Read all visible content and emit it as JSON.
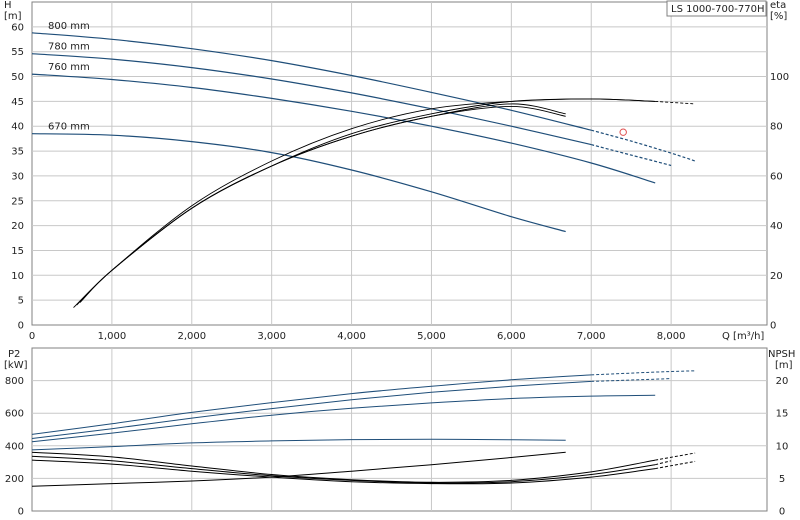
{
  "title": "LS 1000-700-770H",
  "colors": {
    "curve_blue": "#1f4e79",
    "curve_black": "#000000",
    "grid": "#c8c8c8",
    "marker": "#e05050"
  },
  "chart_data": [
    {
      "type": "line",
      "name_key": "head",
      "ylabel_left": "H",
      "ylabel_left_unit": "[m]",
      "ylabel_right": "eta",
      "ylabel_right_unit": "[%]",
      "xlabel": "Q [m³/h]",
      "xlim": [
        0,
        9200
      ],
      "ylim": [
        0,
        65
      ],
      "y2lim": [
        0,
        130
      ],
      "xticks": [
        0,
        1000,
        2000,
        3000,
        4000,
        5000,
        6000,
        7000,
        8000
      ],
      "xtick_labels": [
        "0",
        "1,000",
        "2,000",
        "3,000",
        "4,000",
        "5,000",
        "6,000",
        "7,000",
        "8,000"
      ],
      "yticks": [
        0,
        5,
        10,
        15,
        20,
        25,
        30,
        35,
        40,
        45,
        50,
        55,
        60
      ],
      "y2ticks": [
        0,
        20,
        40,
        60,
        80,
        100
      ],
      "grid": true,
      "head_series": [
        {
          "label": "800 mm",
          "x": [
            0,
            1000,
            2000,
            3000,
            4000,
            5000,
            6000,
            7000
          ],
          "y": [
            58.8,
            57.5,
            55.6,
            53.2,
            50.2,
            46.8,
            43.2,
            39.2
          ],
          "dashed_x": [
            7000,
            7500,
            8000,
            8300
          ],
          "dashed_y": [
            39.2,
            37.0,
            34.6,
            33.0
          ]
        },
        {
          "label": "780 mm",
          "x": [
            0,
            1000,
            2000,
            3000,
            4000,
            5000,
            6000,
            7000
          ],
          "y": [
            54.6,
            53.5,
            51.8,
            49.5,
            46.7,
            43.5,
            40.0,
            36.3
          ],
          "dashed_x": [
            7000,
            7500,
            8000
          ],
          "dashed_y": [
            36.3,
            34.2,
            32.1
          ]
        },
        {
          "label": "760 mm",
          "x": [
            0,
            1000,
            2000,
            3000,
            4000,
            5000,
            6000,
            7000,
            7800
          ],
          "y": [
            50.5,
            49.4,
            47.8,
            45.6,
            43.0,
            40.0,
            36.6,
            32.6,
            28.6
          ],
          "dashed_x": [],
          "dashed_y": []
        },
        {
          "label": "670 mm",
          "x": [
            0,
            1000,
            2000,
            3000,
            4000,
            5000,
            6000,
            6680
          ],
          "y": [
            38.5,
            38.2,
            36.9,
            34.7,
            31.2,
            26.8,
            21.8,
            18.8
          ],
          "dashed_x": [],
          "dashed_y": []
        }
      ],
      "eta_series": [
        {
          "x": [
            520,
            1000,
            2000,
            3000,
            4000,
            5000,
            6000,
            7000,
            7800
          ],
          "y": [
            7,
            22,
            48,
            66,
            79,
            87,
            90,
            91,
            90
          ],
          "dashed_x": [
            7800,
            8300
          ],
          "dashed_y": [
            90,
            89
          ]
        },
        {
          "x": [
            560,
            1000,
            2000,
            3000,
            4000,
            5000,
            6000,
            7000,
            7800
          ],
          "y": [
            8,
            22,
            47,
            64,
            77,
            85,
            90,
            91,
            90
          ],
          "dashed_x": [],
          "dashed_y": []
        },
        {
          "x": [
            600,
            1000,
            2000,
            3000,
            4000,
            5000,
            6000,
            6680
          ],
          "y": [
            9,
            22,
            47,
            64,
            76,
            84,
            89,
            85
          ],
          "dashed_x": [],
          "dashed_y": []
        },
        {
          "x": [
            620,
            1000,
            2000,
            3000,
            4000,
            5000,
            6000,
            6680
          ],
          "y": [
            10,
            22,
            47,
            64,
            76,
            84,
            88,
            84
          ],
          "dashed_x": [],
          "dashed_y": []
        }
      ],
      "operating_point": {
        "x": 7400,
        "y": 38.8
      }
    },
    {
      "type": "line",
      "name_key": "power_npsh",
      "ylabel_left": "P2",
      "ylabel_left_unit": "[kW]",
      "ylabel_right": "NPSH",
      "ylabel_right_unit": "[m]",
      "xlim": [
        0,
        9200
      ],
      "ylim": [
        0,
        1000
      ],
      "y2lim": [
        0,
        25
      ],
      "yticks": [
        0,
        200,
        400,
        600,
        800
      ],
      "y2ticks": [
        0,
        5,
        10,
        15,
        20
      ],
      "grid": true,
      "power_series": [
        {
          "x": [
            0,
            1000,
            2000,
            3000,
            4000,
            5000,
            6000,
            7000
          ],
          "y": [
            470,
            535,
            605,
            665,
            720,
            765,
            805,
            835
          ],
          "dashed_x": [
            7000,
            7800,
            8300
          ],
          "dashed_y": [
            835,
            852,
            860
          ]
        },
        {
          "x": [
            0,
            1000,
            2000,
            3000,
            4000,
            5000,
            6000,
            7000
          ],
          "y": [
            445,
            505,
            570,
            628,
            682,
            728,
            765,
            795
          ],
          "dashed_x": [
            7000,
            8000
          ],
          "dashed_y": [
            795,
            812
          ]
        },
        {
          "x": [
            0,
            1000,
            2000,
            3000,
            4000,
            5000,
            6000,
            7000,
            7800
          ],
          "y": [
            425,
            478,
            535,
            588,
            630,
            663,
            690,
            705,
            710
          ],
          "dashed_x": [],
          "dashed_y": []
        },
        {
          "x": [
            0,
            1000,
            2000,
            3000,
            4000,
            5000,
            6000,
            6680
          ],
          "y": [
            375,
            395,
            418,
            430,
            438,
            440,
            437,
            434
          ],
          "dashed_x": [],
          "dashed_y": []
        }
      ],
      "npsh_series": [
        {
          "x": [
            0,
            1000,
            2000,
            3000,
            4000,
            5000,
            6000,
            6680
          ],
          "y": [
            3.8,
            4.2,
            4.6,
            5.2,
            6.1,
            7.1,
            8.2,
            9.0
          ],
          "dashed_x": [],
          "dashed_y": []
        },
        {
          "x": [
            0,
            1000,
            2000,
            3000,
            4000,
            5000,
            6000,
            7000,
            7800
          ],
          "y": [
            9.0,
            8.3,
            6.9,
            5.6,
            4.8,
            4.4,
            4.7,
            6.0,
            7.8
          ],
          "dashed_x": [
            7800,
            8300
          ],
          "dashed_y": [
            7.8,
            8.9
          ]
        },
        {
          "x": [
            0,
            1000,
            2000,
            3000,
            4000,
            5000,
            6000,
            7000,
            7800
          ],
          "y": [
            8.4,
            7.7,
            6.5,
            5.4,
            4.7,
            4.3,
            4.5,
            5.6,
            7.1
          ],
          "dashed_x": [
            7800,
            8000
          ],
          "dashed_y": [
            7.1,
            7.7
          ]
        },
        {
          "x": [
            0,
            1000,
            2000,
            3000,
            4000,
            5000,
            6000,
            7000,
            7800
          ],
          "y": [
            7.8,
            7.2,
            6.1,
            5.2,
            4.5,
            4.2,
            4.3,
            5.2,
            6.5
          ],
          "dashed_x": [
            7800,
            8300
          ],
          "dashed_y": [
            6.5,
            7.6
          ]
        }
      ]
    }
  ]
}
